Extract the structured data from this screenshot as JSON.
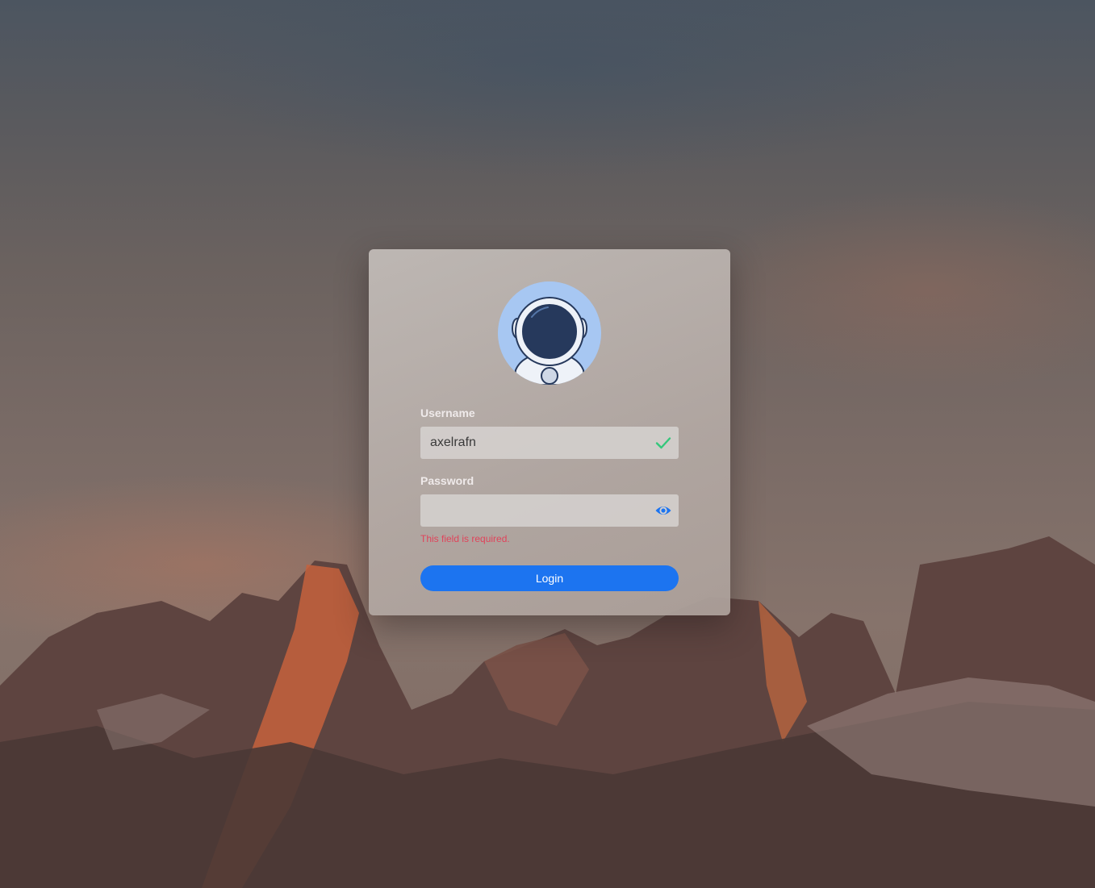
{
  "login_form": {
    "username_label": "Username",
    "username_value": "axelrafn",
    "password_label": "Password",
    "password_value": "",
    "password_error": "This field is required.",
    "login_button_label": "Login"
  },
  "icons": {
    "avatar": "astronaut-avatar-icon",
    "username_status": "checkmark-icon",
    "password_toggle": "eye-icon"
  },
  "colors": {
    "primary": "#1c74f0",
    "success": "#34c77b",
    "error": "#e0435a",
    "avatar_background": "#a7c7f2",
    "avatar_helmet": "#26395c"
  }
}
